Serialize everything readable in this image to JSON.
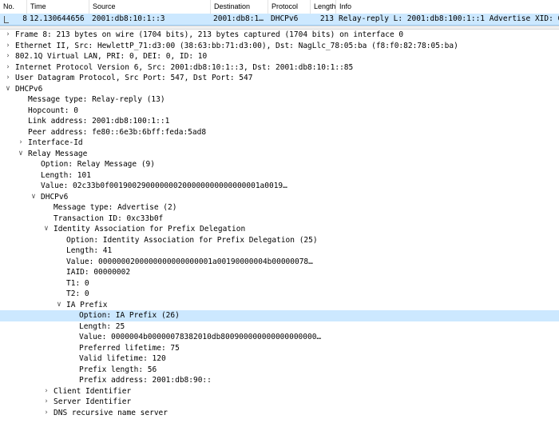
{
  "columns": {
    "no": "No.",
    "time": "Time",
    "source": "Source",
    "destination": "Destination",
    "protocol": "Protocol",
    "length": "Length",
    "info": "Info"
  },
  "packet": {
    "no": "8",
    "time": "12.130644656",
    "source": "2001:db8:10:1::3",
    "destination": "2001:db8:1…",
    "protocol": "DHCPv6",
    "length": "213",
    "info": "Relay-reply L: 2001:db8:100:1::1 Advertise XID: 0"
  },
  "tree": [
    {
      "text": "Frame 8: 213 bytes on wire (1704 bits), 213 bytes captured (1704 bits) on interface 0",
      "expander": "collapsed",
      "level": 0
    },
    {
      "text": "Ethernet II, Src: HewlettP_71:d3:00 (38:63:bb:71:d3:00), Dst: NagLlc_78:05:ba (f8:f0:82:78:05:ba)",
      "expander": "collapsed",
      "level": 0
    },
    {
      "text": "802.1Q Virtual LAN, PRI: 0, DEI: 0, ID: 10",
      "expander": "collapsed",
      "level": 0
    },
    {
      "text": "Internet Protocol Version 6, Src: 2001:db8:10:1::3, Dst: 2001:db8:10:1::85",
      "expander": "collapsed",
      "level": 0
    },
    {
      "text": "User Datagram Protocol, Src Port: 547, Dst Port: 547",
      "expander": "collapsed",
      "level": 0
    },
    {
      "text": "DHCPv6",
      "expander": "expanded",
      "level": 0
    },
    {
      "text": "Message type: Relay-reply (13)",
      "expander": "",
      "level": 1
    },
    {
      "text": "Hopcount: 0",
      "expander": "",
      "level": 1
    },
    {
      "text": "Link address: 2001:db8:100:1::1",
      "expander": "",
      "level": 1
    },
    {
      "text": "Peer address: fe80::6e3b:6bff:feda:5ad8",
      "expander": "",
      "level": 1
    },
    {
      "text": "Interface-Id",
      "expander": "collapsed",
      "level": 1
    },
    {
      "text": "Relay Message",
      "expander": "expanded",
      "level": 1
    },
    {
      "text": "Option: Relay Message (9)",
      "expander": "",
      "level": 2
    },
    {
      "text": "Length: 101",
      "expander": "",
      "level": 2
    },
    {
      "text": "Value: 02c33b0f001900290000000200000000000000001a0019…",
      "expander": "",
      "level": 2
    },
    {
      "text": "DHCPv6",
      "expander": "expanded",
      "level": 2
    },
    {
      "text": "Message type: Advertise (2)",
      "expander": "",
      "level": 3
    },
    {
      "text": "Transaction ID: 0xc33b0f",
      "expander": "",
      "level": 3
    },
    {
      "text": "Identity Association for Prefix Delegation",
      "expander": "expanded",
      "level": 3
    },
    {
      "text": "Option: Identity Association for Prefix Delegation (25)",
      "expander": "",
      "level": 4
    },
    {
      "text": "Length: 41",
      "expander": "",
      "level": 4
    },
    {
      "text": "Value: 0000000200000000000000001a00190000004b00000078…",
      "expander": "",
      "level": 4
    },
    {
      "text": "IAID: 00000002",
      "expander": "",
      "level": 4
    },
    {
      "text": "T1: 0",
      "expander": "",
      "level": 4
    },
    {
      "text": "T2: 0",
      "expander": "",
      "level": 4
    },
    {
      "text": "IA Prefix",
      "expander": "expanded",
      "level": 4
    },
    {
      "text": "Option: IA Prefix (26)",
      "expander": "",
      "level": 5,
      "selected": true
    },
    {
      "text": "Length: 25",
      "expander": "",
      "level": 5
    },
    {
      "text": "Value: 0000004b00000078382010db800900000000000000000…",
      "expander": "",
      "level": 5
    },
    {
      "text": "Preferred lifetime: 75",
      "expander": "",
      "level": 5
    },
    {
      "text": "Valid lifetime: 120",
      "expander": "",
      "level": 5
    },
    {
      "text": "Prefix length: 56",
      "expander": "",
      "level": 5
    },
    {
      "text": "Prefix address: 2001:db8:90::",
      "expander": "",
      "level": 5
    },
    {
      "text": "Client Identifier",
      "expander": "collapsed",
      "level": 3
    },
    {
      "text": "Server Identifier",
      "expander": "collapsed",
      "level": 3
    },
    {
      "text": "DNS recursive name server",
      "expander": "collapsed",
      "level": 3
    }
  ],
  "colors": {
    "selected_row": "#cce8ff",
    "header_border": "#e3e3e3"
  }
}
